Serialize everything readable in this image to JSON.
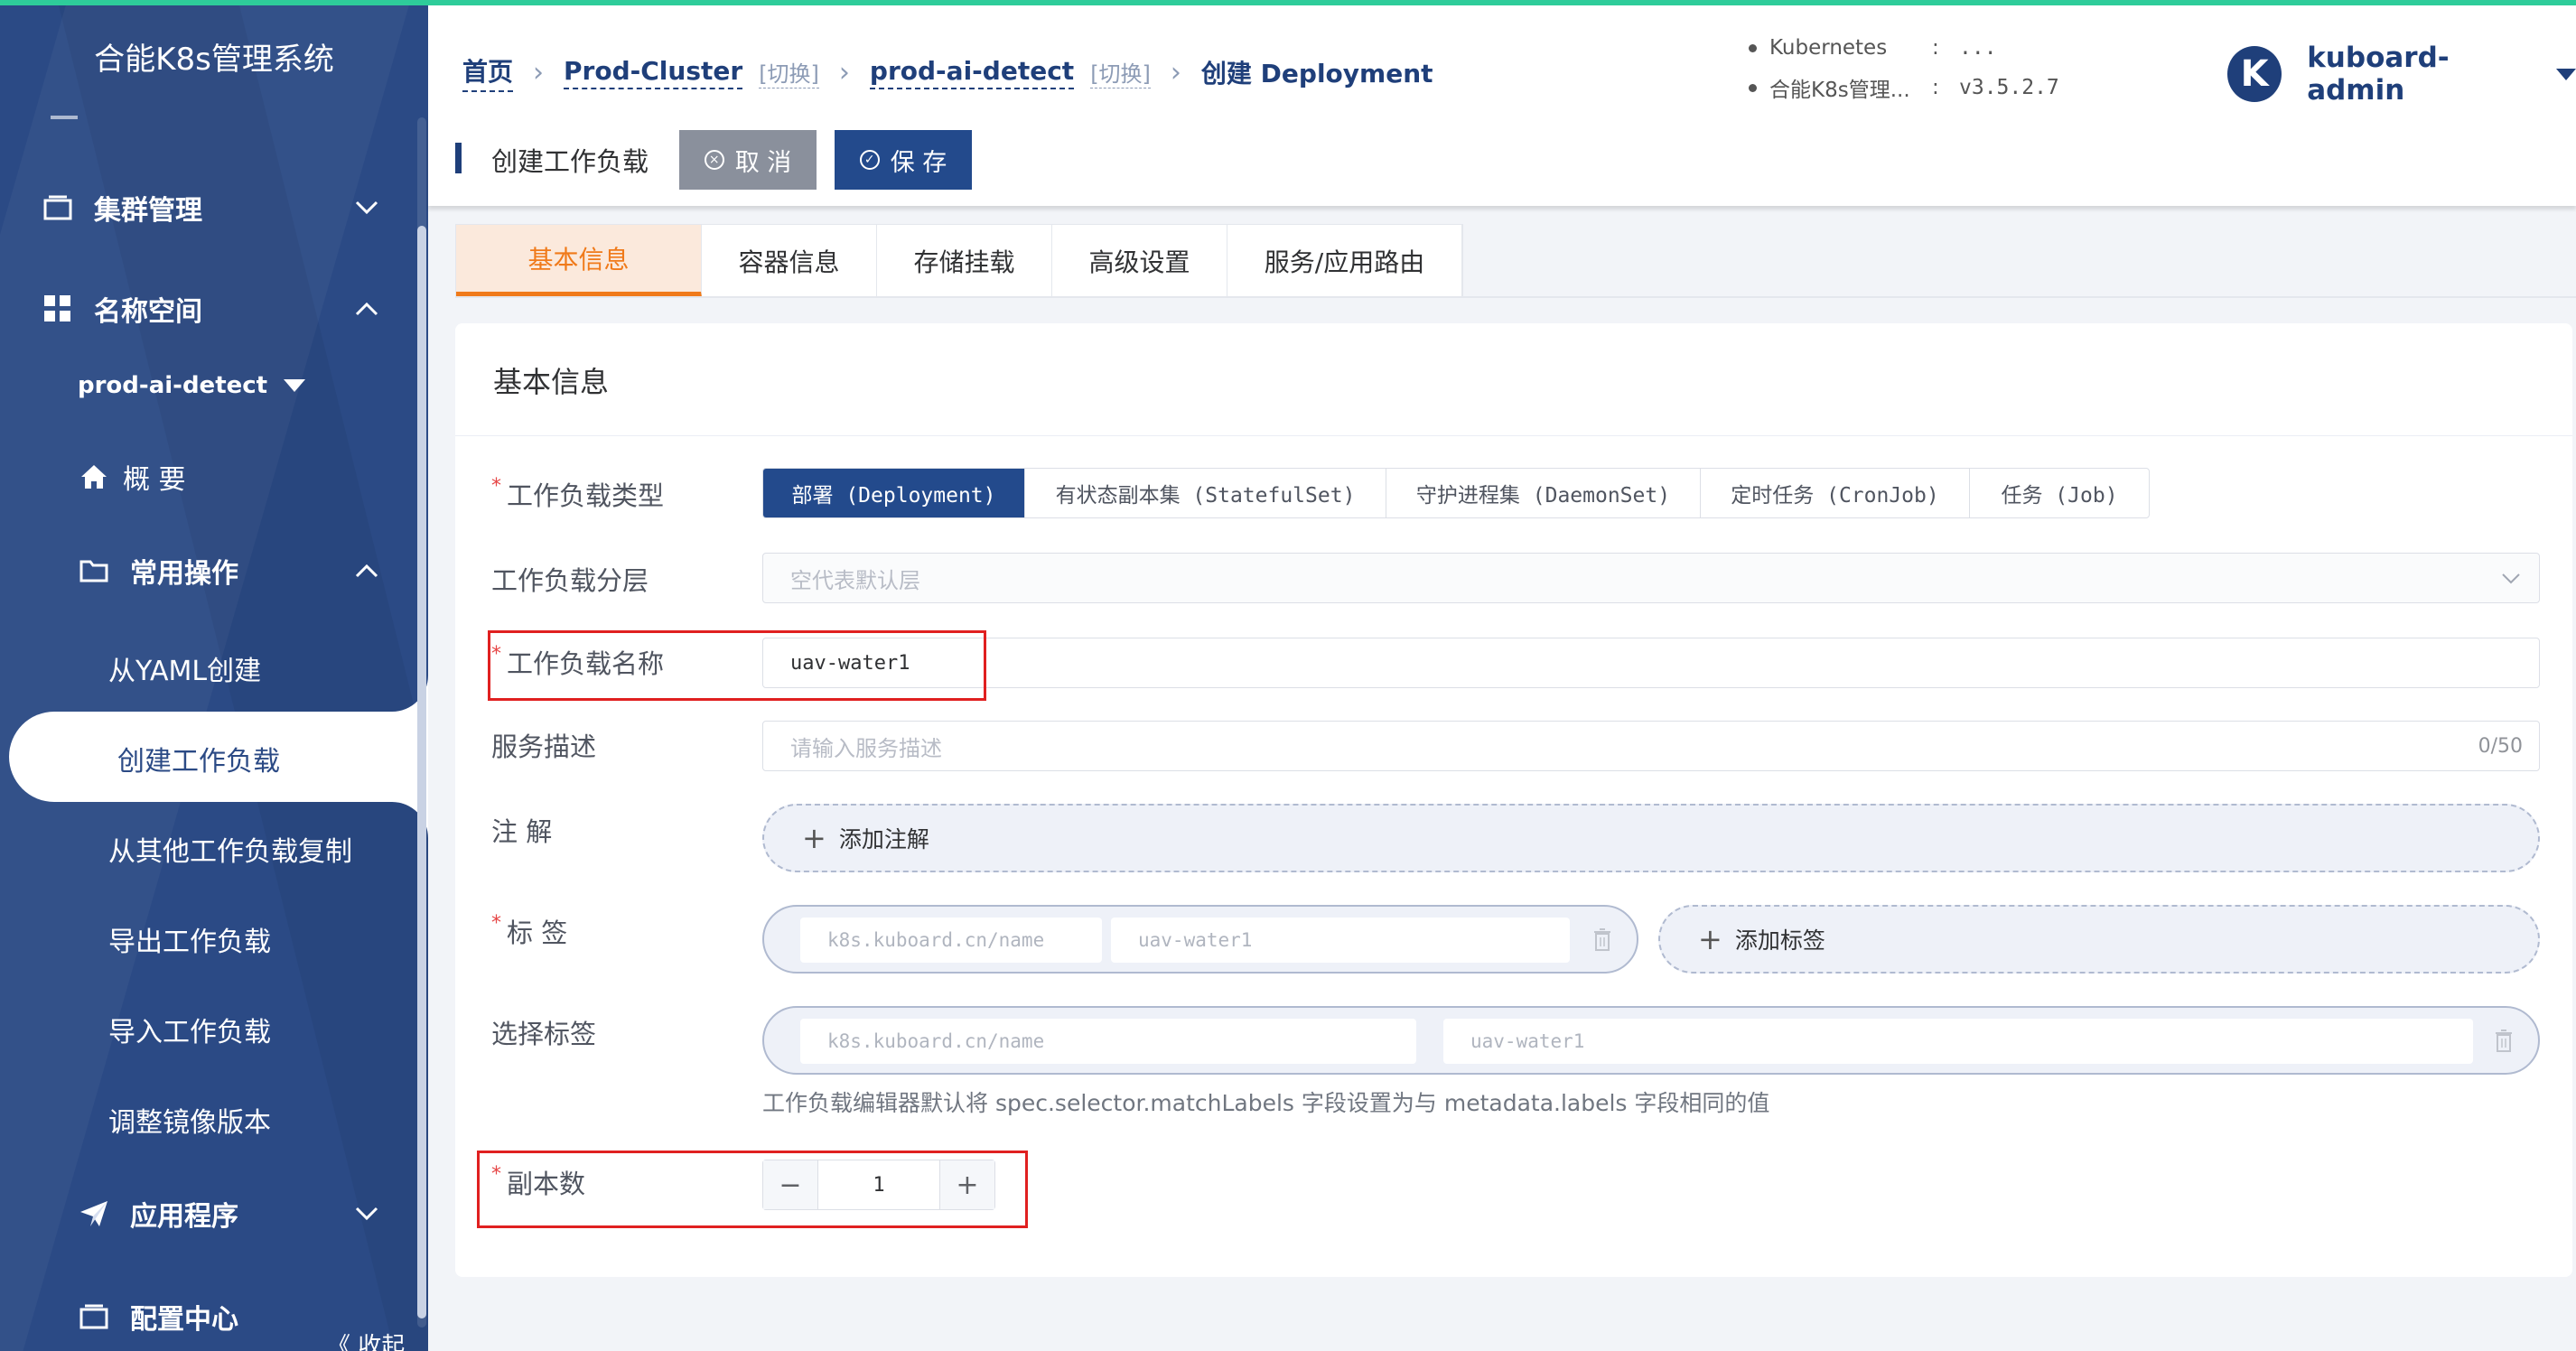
{
  "sidebar": {
    "title": "合能K8s管理系统",
    "groups": {
      "cluster": "集群管理",
      "namespace": "名称空间",
      "common_ops": "常用操作",
      "apps": "应用程序",
      "config": "配置中心"
    },
    "namespace_select": "prod-ai-detect",
    "overview": "概 要",
    "items": [
      "从YAML创建",
      "创建工作负载",
      "从其他工作负载复制",
      "导出工作负载",
      "导入工作负载",
      "调整镜像版本"
    ],
    "collapse": "《 收起"
  },
  "header": {
    "breadcrumb": {
      "home": "首页",
      "cluster": "Prod-Cluster",
      "cluster_switch": "[切换]",
      "namespace": "prod-ai-detect",
      "namespace_switch": "[切换]",
      "current": "创建 Deployment"
    },
    "versions": [
      {
        "name": "Kubernetes",
        "sep": ":",
        "value": "..."
      },
      {
        "name": "合能K8s管理...",
        "sep": ":",
        "value": "v3.5.2.7"
      }
    ],
    "user": {
      "avatar_letter": "K",
      "name": "kuboard-admin"
    }
  },
  "actionbar": {
    "title": "创建工作负载",
    "cancel": "取 消",
    "save": "保 存"
  },
  "tabs": [
    "基本信息",
    "容器信息",
    "存储挂载",
    "高级设置",
    "服务/应用路由"
  ],
  "form": {
    "section_title": "基本信息",
    "labels": {
      "workload_type": "工作负载类型",
      "layer": "工作负载分层",
      "name": "工作负载名称",
      "desc": "服务描述",
      "annotations": "注 解",
      "tags": "标 签",
      "selector": "选择标签",
      "replicas": "副本数"
    },
    "workload_types": [
      "部署 (Deployment)",
      "有状态副本集 (StatefulSet)",
      "守护进程集 (DaemonSet)",
      "定时任务 (CronJob)",
      "任务 (Job)"
    ],
    "selected_type": "部署 (Deployment)",
    "layer_placeholder": "空代表默认层",
    "name_value": "uav-water1",
    "desc_placeholder": "请输入服务描述",
    "desc_count": "0/50",
    "add_annotation": "添加注解",
    "tag_key": "k8s.kuboard.cn/name",
    "tag_value": "uav-water1",
    "add_tag": "添加标签",
    "selector_key": "k8s.kuboard.cn/name",
    "selector_value": "uav-water1",
    "selector_hint": "工作负载编辑器默认将 spec.selector.matchLabels 字段设置为与 metadata.labels 字段相同的值",
    "replicas_value": "1",
    "minus": "−",
    "plus": "+"
  },
  "colors": {
    "sidebar": "#2b4a85",
    "primary": "#234a8c",
    "tab_active": "#f07a1a",
    "highlight": "#e02020"
  }
}
